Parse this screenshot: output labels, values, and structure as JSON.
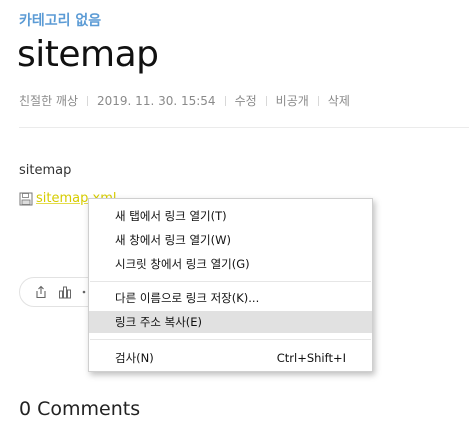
{
  "post": {
    "category": "카테고리 없음",
    "title": "sitemap",
    "meta": {
      "author": "친절한 깨상",
      "date": "2019. 11. 30. 15:54",
      "edit": "수정",
      "private": "비공개",
      "delete": "삭제"
    },
    "body_text": "sitemap",
    "attachment": {
      "icon": "floppy-disk-icon",
      "link_text": "sitemap.xml"
    }
  },
  "share_bar": {
    "icons": [
      "share-icon",
      "bar-chart-icon",
      "more-icon"
    ]
  },
  "context_menu": {
    "items": [
      {
        "label": "새 탭에서 링크 열기(T)",
        "shortcut": ""
      },
      {
        "label": "새 창에서 링크 열기(W)",
        "shortcut": ""
      },
      {
        "label": "시크릿 창에서 링크 열기(G)",
        "shortcut": ""
      },
      {
        "label": "다른 이름으로 링크 저장(K)...",
        "shortcut": ""
      },
      {
        "label": "링크 주소 복사(E)",
        "shortcut": "",
        "highlighted": true
      },
      {
        "label": "검사(N)",
        "shortcut": "Ctrl+Shift+I"
      }
    ]
  },
  "comments": {
    "label": "0 Comments"
  },
  "colors": {
    "category": "#5b9bd5",
    "link": "#d6cc00",
    "menu_highlight": "#e1e1e1"
  }
}
